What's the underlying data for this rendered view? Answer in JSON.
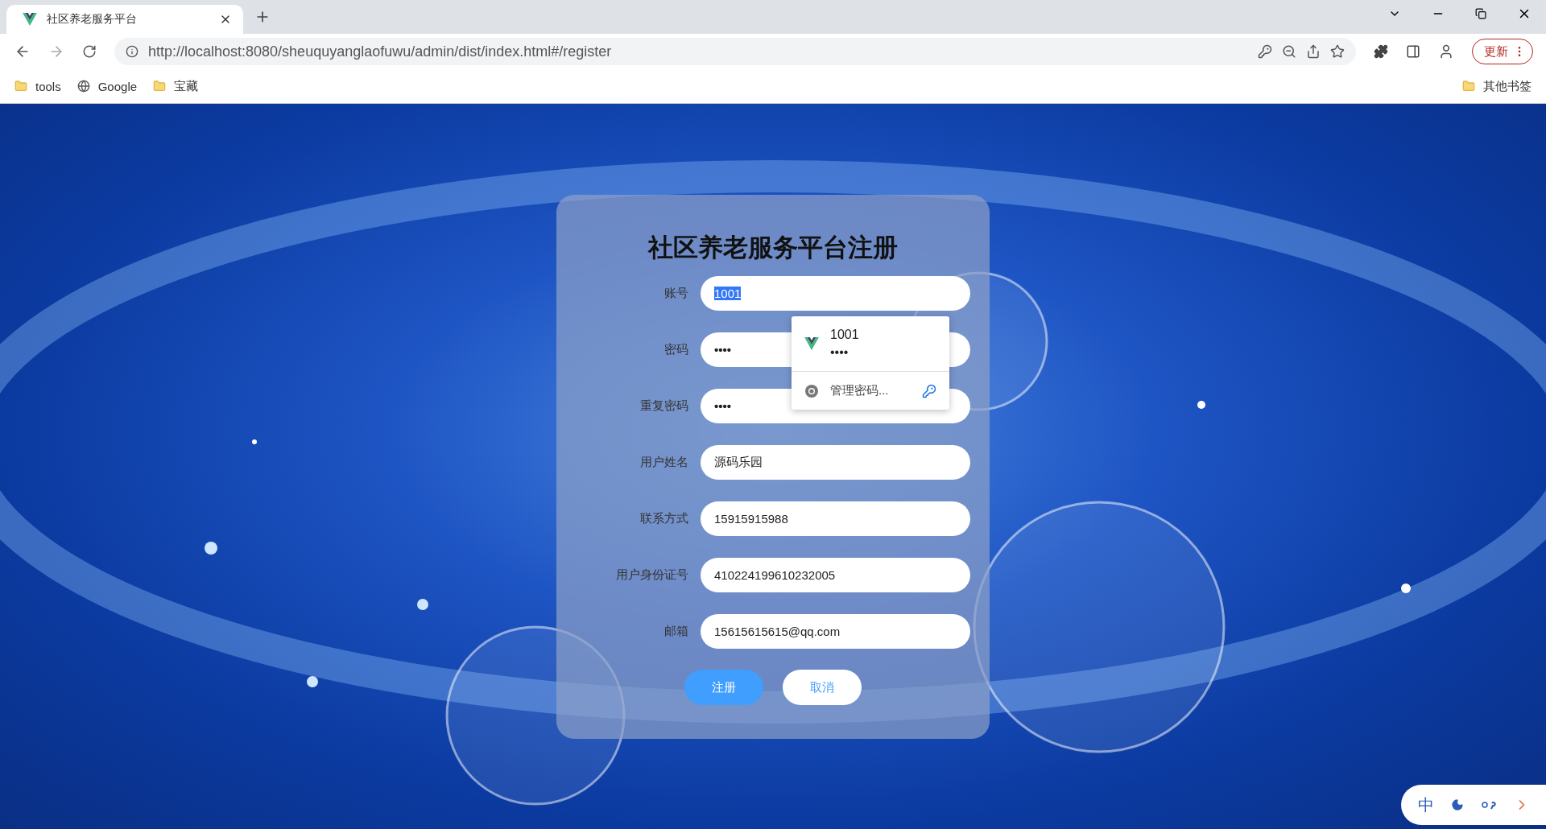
{
  "browser": {
    "tabs": [
      {
        "title": "社区养老服务平台",
        "selected": true
      }
    ],
    "address": "http://localhost:8080/sheuquyanglaofuwu/admin/dist/index.html#/register",
    "update_button": "更新",
    "bookmarks": [
      {
        "label": "tools",
        "kind": "folder"
      },
      {
        "label": "Google",
        "kind": "site"
      },
      {
        "label": "宝藏",
        "kind": "folder"
      }
    ],
    "other_bookmarks": "其他书签"
  },
  "form": {
    "title": "社区养老服务平台注册",
    "fields": [
      {
        "label": "账号",
        "value": "1001",
        "kind": "text",
        "highlighted": true
      },
      {
        "label": "密码",
        "value": "••••",
        "kind": "password",
        "highlighted": false
      },
      {
        "label": "重复密码",
        "value": "••••",
        "kind": "password",
        "highlighted": false
      },
      {
        "label": "用户姓名",
        "value": "源码乐园",
        "kind": "text",
        "highlighted": false
      },
      {
        "label": "联系方式",
        "value": "15915915988",
        "kind": "text",
        "highlighted": false
      },
      {
        "label": "用户身份证号",
        "value": "410224199610232005",
        "kind": "text",
        "highlighted": false
      },
      {
        "label": "邮箱",
        "value": "15615615615@qq.com",
        "kind": "text",
        "highlighted": false
      }
    ],
    "buttons": [
      {
        "label": "注册",
        "kind": "primary"
      },
      {
        "label": "取消",
        "kind": "secondary"
      }
    ]
  },
  "autofill_popup": {
    "username": "1001",
    "password": "••••",
    "manage": "管理密码..."
  },
  "ime_bar": {
    "mode": "中"
  }
}
